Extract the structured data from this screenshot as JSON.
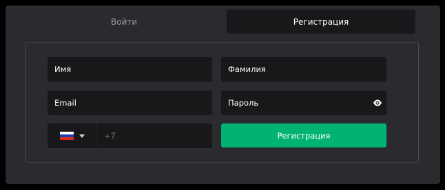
{
  "tabs": {
    "login_label": "Войти",
    "register_label": "Регистрация",
    "active": "register"
  },
  "form": {
    "name_placeholder": "Имя",
    "surname_placeholder": "Фамилия",
    "email_placeholder": "Email",
    "password_placeholder": "Пароль",
    "password_toggle_icon": "eye-icon",
    "phone": {
      "country_flag": "flag-russia-icon",
      "dial_code": "+7",
      "value": ""
    },
    "submit_label": "Регистрация"
  },
  "colors": {
    "background": "#2a2a2f",
    "field_bg": "#18181a",
    "accent": "#00b373",
    "tab_inactive_text": "#9a9aa2"
  }
}
